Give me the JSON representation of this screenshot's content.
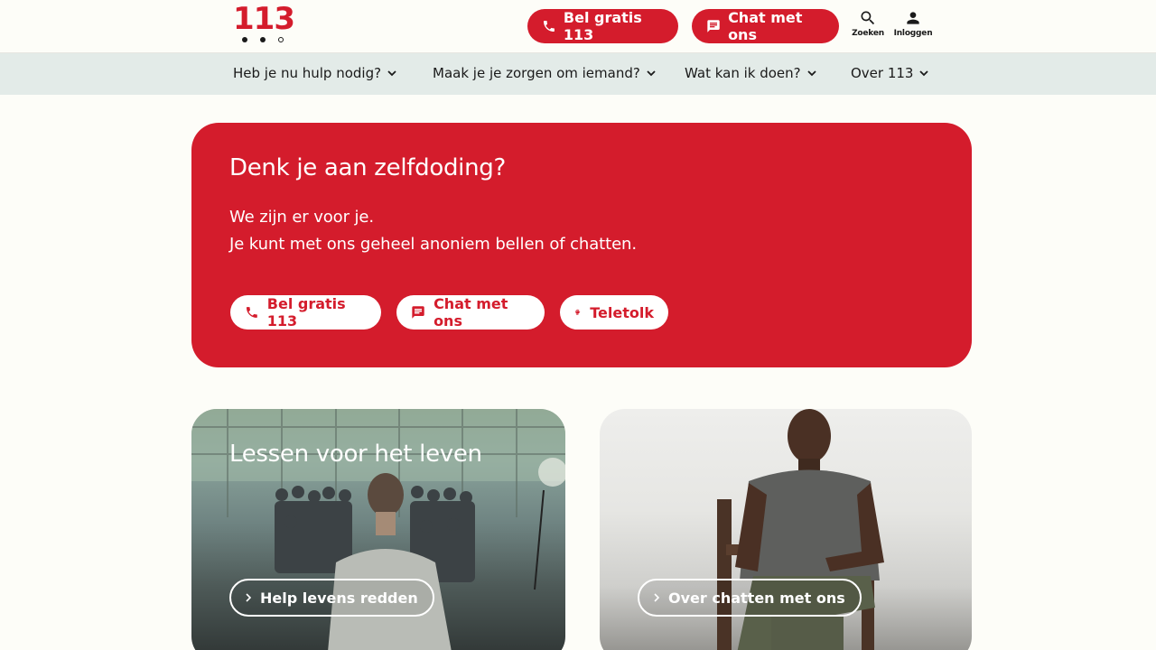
{
  "header": {
    "logo": {
      "number": "113"
    },
    "call_button": {
      "label": "Bel gratis 113",
      "icon": "phone-icon"
    },
    "chat_button": {
      "label": "Chat met ons",
      "icon": "chat-icon"
    },
    "search": {
      "label": "Zoeken",
      "icon": "search-icon"
    },
    "login": {
      "label": "Inloggen",
      "icon": "person-icon"
    }
  },
  "nav": {
    "items": [
      {
        "label": "Heb je nu hulp nodig?"
      },
      {
        "label": "Maak je je zorgen om iemand?"
      },
      {
        "label": "Wat kan ik doen?"
      },
      {
        "label": "Over 113"
      }
    ]
  },
  "hero": {
    "title": "Denk je aan zelfdoding?",
    "line1": "We zijn er voor je.",
    "line2": "Je kunt met ons geheel anoniem bellen of chatten.",
    "buttons": [
      {
        "label": "Bel gratis 113",
        "icon": "phone-icon"
      },
      {
        "label": "Chat met ons",
        "icon": "chat-icon"
      },
      {
        "label": "Teletolk",
        "icon": "sign-language-icon"
      }
    ]
  },
  "cards": [
    {
      "title": "Lessen voor het leven",
      "button": "Help levens redden"
    },
    {
      "title": "",
      "button": "Over chatten met ons"
    }
  ],
  "colors": {
    "brand_red": "#d41c2c",
    "nav_bg": "#e3ebe8",
    "page_bg": "#fdfdf8"
  }
}
